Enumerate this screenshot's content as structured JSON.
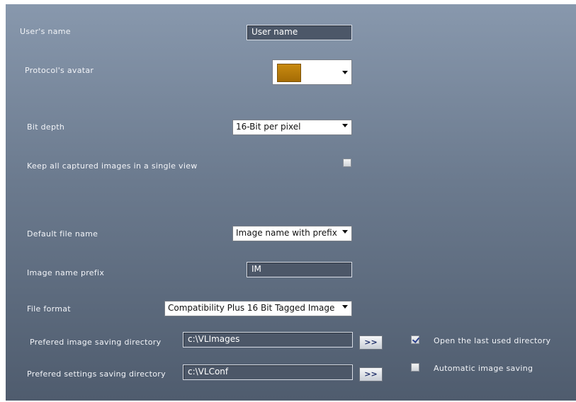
{
  "labels": {
    "user_name": "User's name",
    "protocol_avatar": "Protocol's avatar",
    "bit_depth": "Bit depth",
    "keep_images": "Keep all captured images in a single view",
    "default_file_name": "Default file name",
    "image_name_prefix": "Image name prefix",
    "file_format": "File format",
    "image_dir": "Prefered image saving directory",
    "settings_dir": "Prefered settings saving directory"
  },
  "fields": {
    "user_name_value": "User name",
    "prefix_value": "IM",
    "image_dir_value": "c:\\VLImages",
    "settings_dir_value": "c:\\VLConf"
  },
  "selects": {
    "avatar_value": "",
    "avatar_color": "#c0850e",
    "bit_depth_value": "16-Bit per pixel",
    "default_file_name_value": "Image name with prefix",
    "file_format_value": "Compatibility Plus 16 Bit Tagged Image"
  },
  "buttons": {
    "browse_label": ">>"
  },
  "checkboxes": {
    "keep_images_checked": false,
    "open_last_dir_label": "Open the last used directory",
    "open_last_dir_checked": true,
    "auto_save_label": "Automatic image saving",
    "auto_save_checked": false
  }
}
